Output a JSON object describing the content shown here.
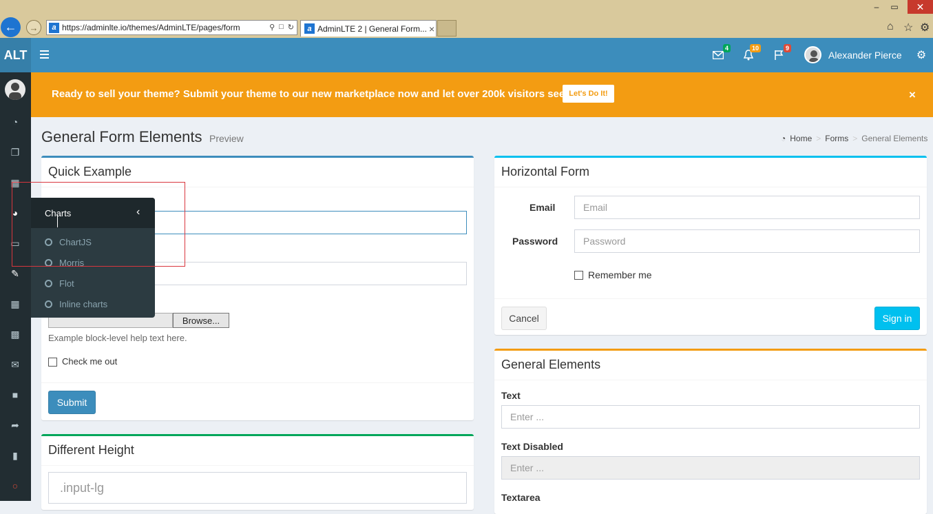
{
  "browser": {
    "url": "https://adminlte.io/themes/AdminLTE/pages/form",
    "tab_title": "AdminLTE 2 | General Form...",
    "tab_close": "×",
    "win_min": "–",
    "win_max": "▭",
    "win_close": "✕"
  },
  "header": {
    "logo": "ALT",
    "user_name": "Alexander Pierce",
    "badges": {
      "messages": "4",
      "notifications": "10",
      "tasks": "9"
    },
    "badge_colors": {
      "messages": "#00a65a",
      "notifications": "#f39c12",
      "tasks": "#dd4b39"
    }
  },
  "callout": {
    "text": "Ready to sell your theme? Submit your theme to our new marketplace now and let over 200k visitors see it!",
    "button": "Let's Do It!",
    "close": "×"
  },
  "page": {
    "title": "General Form Elements",
    "subtitle": "Preview",
    "breadcrumb": [
      "Home",
      "Forms",
      "General Elements"
    ],
    "breadcrumb_sep": ">"
  },
  "quick_example": {
    "title": "Quick Example",
    "help_text": "Example block-level help text here.",
    "browse": "Browse...",
    "check_label": "Check me out",
    "submit": "Submit"
  },
  "different_height": {
    "title": "Different Height",
    "placeholder": ".input-lg"
  },
  "horizontal_form": {
    "title": "Horizontal Form",
    "email_label": "Email",
    "email_placeholder": "Email",
    "password_label": "Password",
    "password_placeholder": "Password",
    "remember": "Remember me",
    "cancel": "Cancel",
    "sign_in": "Sign in"
  },
  "general_elements": {
    "title": "General Elements",
    "text_label": "Text",
    "text_placeholder": "Enter ...",
    "text_disabled_label": "Text Disabled",
    "text_disabled_placeholder": "Enter ...",
    "textarea_label": "Textarea"
  },
  "flyout": {
    "title": "Charts",
    "chevron": "‹",
    "items": [
      "ChartJS",
      "Morris",
      "Flot",
      "Inline charts"
    ]
  }
}
